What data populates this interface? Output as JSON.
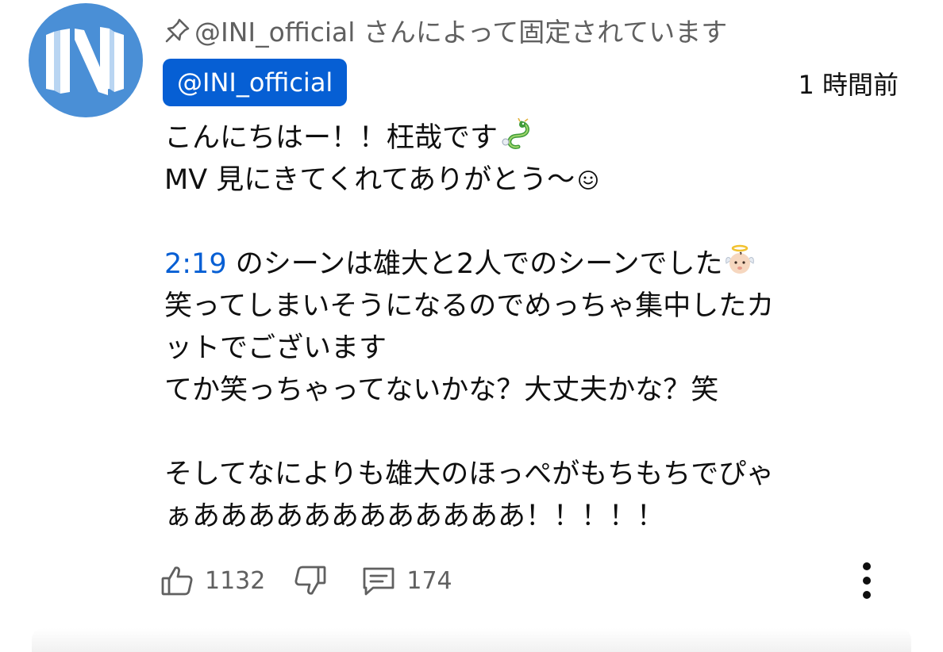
{
  "comment": {
    "avatar_icon": "ini-logo-icon",
    "pinned_label": "@INI_official さんによって固定されています",
    "author_handle": "@INI_official",
    "timestamp": "1 時間前",
    "lines": [
      {
        "text": "こんにちはー！！枉哉です",
        "emoji": "dragon-emoji"
      },
      {
        "text": "MV 見にきてくれてありがとう〜",
        "emoji": "smiley-emoji"
      },
      {
        "text": ""
      },
      {
        "timecode": "2:19",
        "text": " のシーンは雄大と2人でのシーンでした",
        "emoji": "baby-angel-emoji"
      },
      {
        "text": "笑ってしまいそうになるのでめっちゃ集中したカ"
      },
      {
        "text": "ットでございます"
      },
      {
        "text": "てか笑っちゃってないかな？大丈夫かな？笑"
      },
      {
        "text": ""
      },
      {
        "text": "そしてなによりも雄大のほっぺがもちもちでぴゃ"
      },
      {
        "text": "ぁああああああああああああ！！！！！"
      }
    ],
    "actions": {
      "like_icon": "thumbs-up-icon",
      "like_count": "1132",
      "dislike_icon": "thumbs-down-icon",
      "reply_icon": "reply-comment-icon",
      "reply_count": "174",
      "more_icon": "more-vertical-icon"
    },
    "colors": {
      "accent_blue": "#065fd4",
      "avatar_bg": "#4a8fd6",
      "secondary_text": "#606060"
    }
  }
}
